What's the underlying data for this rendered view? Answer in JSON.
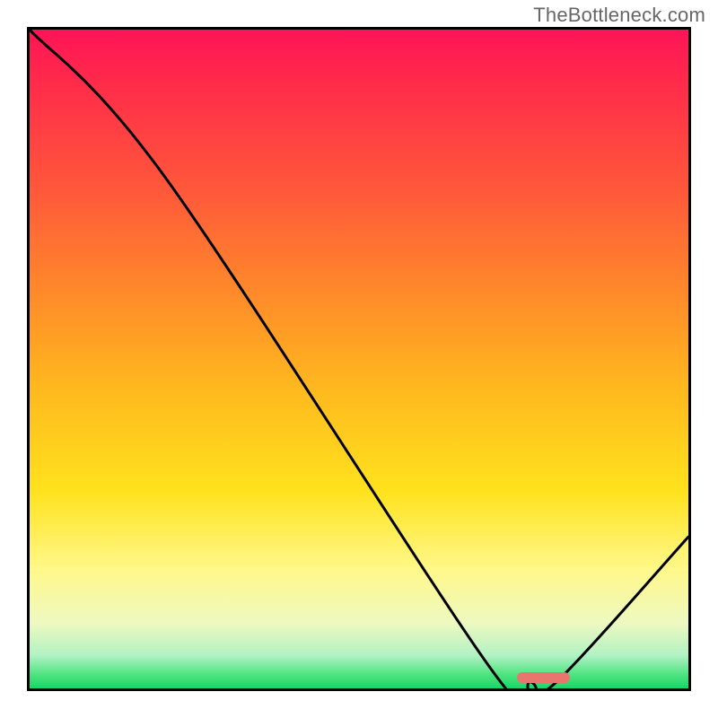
{
  "watermark": "TheBottleneck.com",
  "chart_data": {
    "type": "line",
    "title": "",
    "xlabel": "",
    "ylabel": "",
    "xlim": [
      0,
      100
    ],
    "ylim": [
      0,
      100
    ],
    "x": [
      0,
      21,
      70,
      76,
      80,
      100
    ],
    "values": [
      100,
      77,
      3,
      1,
      1,
      23
    ],
    "optimum_range_x": [
      74,
      82
    ],
    "legend": null,
    "grid": false,
    "colors": {
      "top": "#ff1457",
      "mid": "#ffe21d",
      "bottom": "#18d668",
      "curve": "#000000",
      "marker": "#e9766e"
    }
  }
}
